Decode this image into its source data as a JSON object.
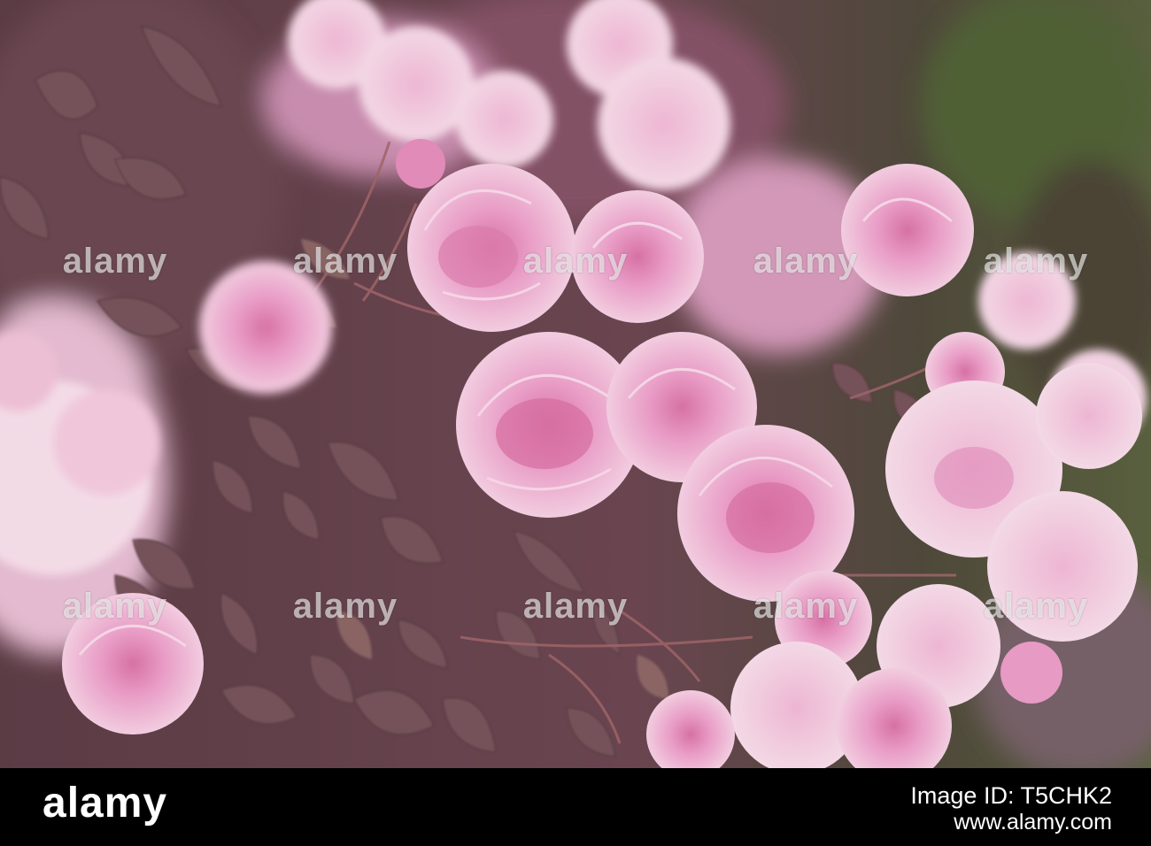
{
  "photo": {
    "subject": "pink-climbing-roses",
    "colors": {
      "bloom_light": "#f7c8e0",
      "bloom_mid": "#ec9cc8",
      "bloom_deep": "#d9709f",
      "leaf": "#6e4f52",
      "leaf_light": "#8e6a66",
      "bg_green": "#3f4b28",
      "bg_dark": "#5a3a43"
    }
  },
  "watermark": {
    "text": "alamy"
  },
  "footer": {
    "logo_text": "alamy",
    "image_id": "Image ID: T5CHK2",
    "url": "www.alamy.com"
  }
}
